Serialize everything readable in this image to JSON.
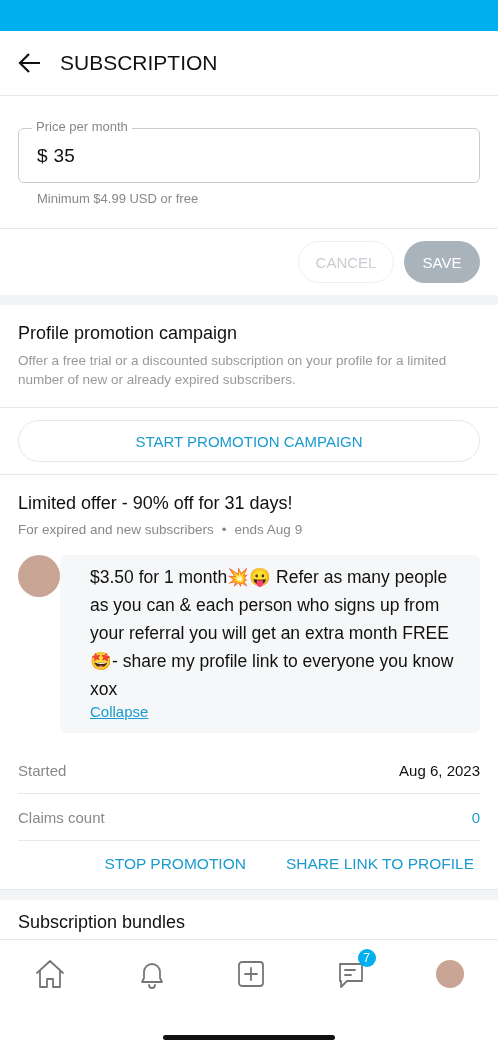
{
  "header": {
    "title": "SUBSCRIPTION"
  },
  "price_field": {
    "label": "Price per month",
    "currency": "$",
    "value": "35",
    "hint": "Minimum $4.99 USD or free"
  },
  "actions": [
    {
      "label": "CANCEL",
      "kind": "outline",
      "disabled": true
    },
    {
      "label": "SAVE",
      "kind": "filled",
      "disabled": true
    }
  ],
  "promotion": {
    "title": "Profile promotion campaign",
    "description": "Offer a free trial or a discounted subscription on your profile for a limited number of new or already expired subscribers.",
    "button": "START PROMOTION CAMPAIGN"
  },
  "offer": {
    "title": "Limited offer - 90% off for 31 days!",
    "audience": "For expired and new subscribers",
    "separator": "•",
    "ends": "ends Aug 9",
    "message": "$3.50 for 1 month💥😛 Refer as many people as you can & each person who signs up from your referral you will get an extra month FREE 🤩- share my profile link to everyone you know xox",
    "collapse": "Collapse",
    "stats": [
      {
        "label": "Started",
        "value": "Aug 6, 2023",
        "kind": "plain"
      },
      {
        "label": "Claims count",
        "value": "0",
        "kind": "link"
      }
    ],
    "buttons": [
      "STOP PROMOTION",
      "SHARE LINK TO PROFILE"
    ]
  },
  "next_section": {
    "title": "Subscription bundles"
  },
  "bottom_nav": [
    {
      "kind": "home"
    },
    {
      "kind": "bell"
    },
    {
      "kind": "add"
    },
    {
      "kind": "messages",
      "badge": "7"
    },
    {
      "kind": "avatar"
    }
  ]
}
